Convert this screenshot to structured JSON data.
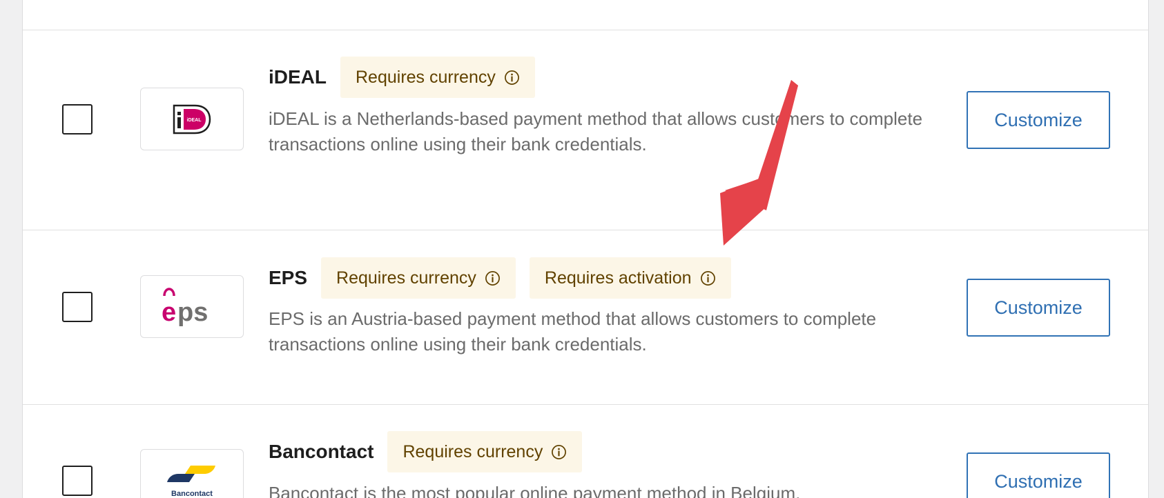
{
  "methods": [
    {
      "name": "iDEAL",
      "badges": [
        "Requires currency"
      ],
      "description": "iDEAL is a Netherlands-based payment method that allows customers to complete transactions online using their bank credentials.",
      "button": "Customize",
      "logo_text": "iDEAL"
    },
    {
      "name": "EPS",
      "badges": [
        "Requires currency",
        "Requires activation"
      ],
      "description": "EPS is an Austria-based payment method that allows customers to complete transactions online using their bank credentials.",
      "button": "Customize",
      "logo_text": "eps"
    },
    {
      "name": "Bancontact",
      "badges": [
        "Requires currency"
      ],
      "description": "Bancontact is the most popular online payment method in Belgium,",
      "button": "Customize",
      "logo_text": "Bancontact"
    }
  ],
  "colors": {
    "badge_bg": "#fcf6e7",
    "badge_text": "#614200",
    "button_border": "#3072b5",
    "arrow": "#e5434a"
  },
  "icons": {
    "badge_info": "info-circle-icon",
    "annotation": "red-arrow-icon"
  }
}
